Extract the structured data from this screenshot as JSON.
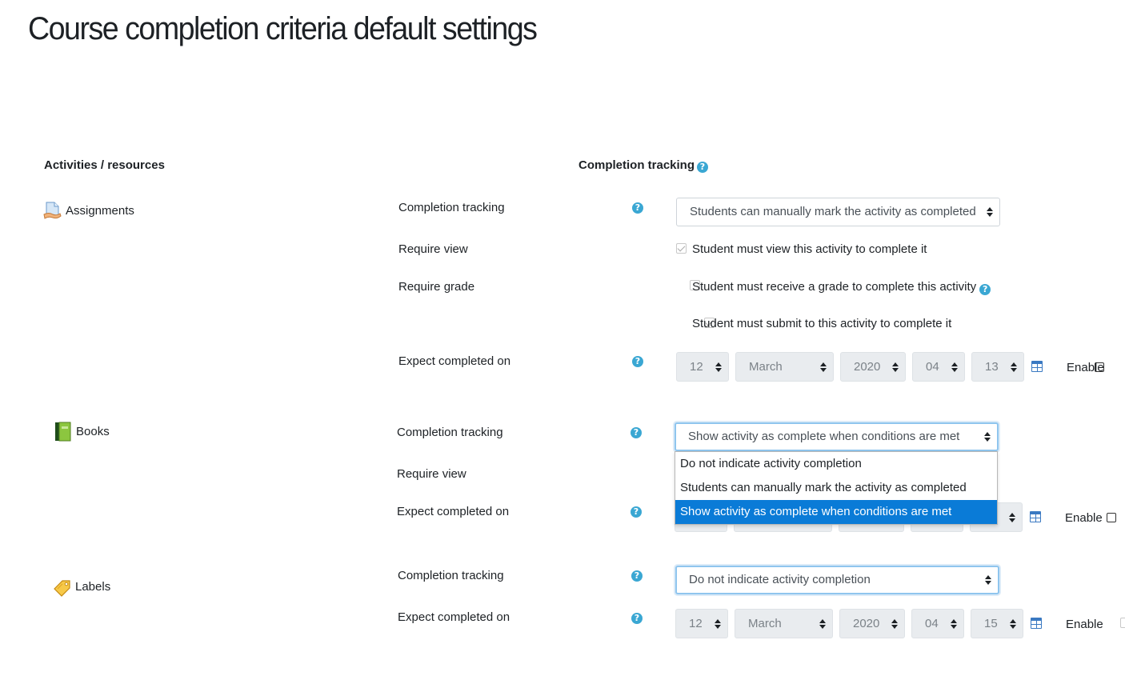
{
  "page": {
    "title": "Course completion criteria default settings"
  },
  "headers": {
    "activities": "Activities / resources",
    "completion": "Completion tracking"
  },
  "help_glyph": "?",
  "assignments": {
    "name": "Assignments",
    "icon": "assignment-icon",
    "tracking_label": "Completion tracking",
    "tracking_value": "Students can manually mark the activity as completed",
    "require_view_label": "Require view",
    "require_view_text": "Student must view this activity to complete it",
    "require_grade_label": "Require grade",
    "require_grade_text": "Student must receive a grade to complete this activity",
    "require_submit_text": "Student must submit to this activity to complete it",
    "expect_label": "Expect completed on",
    "date": {
      "day": "12",
      "month": "March",
      "year": "2020",
      "hour": "04",
      "minute": "13"
    },
    "enable_label": "Enable"
  },
  "books": {
    "name": "Books",
    "icon": "book-icon",
    "tracking_label": "Completion tracking",
    "tracking_value": "Show activity as complete when conditions are met",
    "require_view_label": "Require view",
    "expect_label": "Expect completed on",
    "enable_label": "Enable",
    "dropdown_options": [
      "Do not indicate activity completion",
      "Students can manually mark the activity as completed",
      "Show activity as complete when conditions are met"
    ]
  },
  "labels": {
    "name": "Labels",
    "icon": "label-tag-icon",
    "tracking_label": "Completion tracking",
    "tracking_value": "Do not indicate activity completion",
    "expect_label": "Expect completed on",
    "date": {
      "day": "12",
      "month": "March",
      "year": "2020",
      "hour": "04",
      "minute": "15"
    },
    "enable_label": "Enable"
  },
  "colors": {
    "help": "#3aa7d3",
    "selected_option": "#0a7bd7",
    "focus_ring": "#8fc5ee",
    "calendar": "#3a79c2"
  }
}
